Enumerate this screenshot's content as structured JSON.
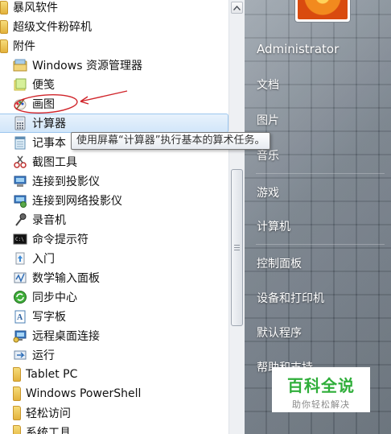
{
  "start_menu": {
    "programs": {
      "folders_top": [
        {
          "label": "暴风软件"
        },
        {
          "label": "超级文件粉碎机"
        },
        {
          "label": "附件"
        }
      ],
      "accessories": [
        {
          "label": "Windows 资源管理器",
          "icon": "explorer-icon"
        },
        {
          "label": "便笺",
          "icon": "sticky-notes-icon"
        },
        {
          "label": "画图",
          "icon": "paint-icon"
        },
        {
          "label": "计算器",
          "icon": "calculator-icon",
          "selected": true
        },
        {
          "label": "记事本",
          "icon": "notepad-icon"
        },
        {
          "label": "截图工具",
          "icon": "snipping-tool-icon"
        },
        {
          "label": "连接到投影仪",
          "icon": "projector-icon"
        },
        {
          "label": "连接到网络投影仪",
          "icon": "network-projector-icon"
        },
        {
          "label": "录音机",
          "icon": "microphone-icon"
        },
        {
          "label": "命令提示符",
          "icon": "command-prompt-icon"
        },
        {
          "label": "入门",
          "icon": "getting-started-icon"
        },
        {
          "label": "数学输入面板",
          "icon": "math-input-icon"
        },
        {
          "label": "同步中心",
          "icon": "sync-center-icon"
        },
        {
          "label": "写字板",
          "icon": "wordpad-icon"
        },
        {
          "label": "远程桌面连接",
          "icon": "remote-desktop-icon"
        },
        {
          "label": "运行",
          "icon": "run-icon"
        }
      ],
      "subfolders": [
        {
          "label": "Tablet PC"
        },
        {
          "label": "Windows PowerShell"
        },
        {
          "label": "轻松访问"
        },
        {
          "label": "系统工具"
        }
      ]
    },
    "tooltip": "使用屏幕“计算器”执行基本的算术任务。",
    "right_pane": {
      "account": "Administrator",
      "items": [
        "文档",
        "图片",
        "音乐",
        "游戏",
        "计算机",
        "控制面板",
        "设备和打印机",
        "默认程序",
        "帮助和支持"
      ]
    }
  },
  "watermark": {
    "title": "百科全说",
    "subtitle": "助你轻松解决"
  },
  "colors": {
    "annotation_red": "#d0242a",
    "selection_blue": "#d2e6f9",
    "watermark_green": "#2fae3a"
  }
}
